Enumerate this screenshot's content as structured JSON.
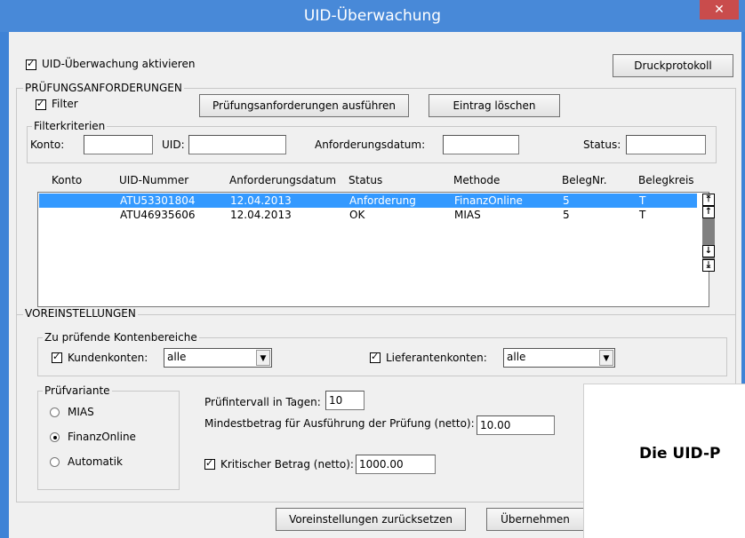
{
  "window": {
    "title": "UID-Überwachung",
    "close_glyph": "✕"
  },
  "top": {
    "activate_label": "UID-Überwachung aktivieren",
    "activate_checked": true,
    "print_button": "Druckprotokoll"
  },
  "pruefung": {
    "group_title": "PRÜFUNGSANFORDERUNGEN",
    "filter_label": "Filter",
    "filter_checked": true,
    "execute_button": "Prüfungsanforderungen ausführen",
    "delete_button": "Eintrag löschen",
    "filter_group_title": "Filterkriterien",
    "konto_label": "Konto:",
    "konto_value": "",
    "uid_label": "UID:",
    "uid_value": "",
    "datum_label": "Anforderungsdatum:",
    "datum_value": "",
    "status_label": "Status:",
    "status_value": ""
  },
  "table": {
    "headers": [
      "Konto",
      "UID-Nummer",
      "Anforderungsdatum",
      "Status",
      "Methode",
      "BelegNr.",
      "Belegkreis"
    ],
    "rows": [
      {
        "konto": "",
        "uid": "ATU53301804",
        "datum": "12.04.2013",
        "status": "Anforderung",
        "methode": "FinanzOnline",
        "belegnr": "5",
        "belegkreis": "T"
      },
      {
        "konto": "",
        "uid": "ATU46935606",
        "datum": "12.04.2013",
        "status": "OK",
        "methode": "MIAS",
        "belegnr": "5",
        "belegkreis": "T"
      }
    ],
    "scroll_top_glyph": "⤒",
    "scroll_up_glyph": "↑",
    "scroll_down_glyph": "↓",
    "scroll_bottom_glyph": "⤓"
  },
  "voreinstellungen": {
    "group_title": "VOREINSTELLUNGEN",
    "konten_group_title": "Zu prüfende Kontenbereiche",
    "kunden_label": "Kundenkonten:",
    "kunden_checked": true,
    "kunden_value": "alle",
    "lieferanten_label": "Lieferantenkonten:",
    "lieferanten_checked": true,
    "lieferanten_value": "alle",
    "variante_group_title": "Prüfvariante",
    "variante_options": [
      "MIAS",
      "FinanzOnline",
      "Automatik"
    ],
    "variante_selected": "FinanzOnline",
    "intervall_label": "Prüfintervall in Tagen:",
    "intervall_value": "10",
    "mindest_label": "Mindestbetrag für Ausführung der Prüfung (netto):",
    "mindest_value": "10.00",
    "kritisch_label": "Kritischer Betrag (netto):",
    "kritisch_checked": true,
    "kritisch_value": "1000.00"
  },
  "bottom": {
    "reset_button": "Voreinstellungen zurücksetzen",
    "apply_button": "Übernehmen"
  },
  "overlay": {
    "text": "Die UID-P"
  },
  "colors": {
    "titlebar": "#4889d8",
    "selection": "#3399ff",
    "close": "#c94c4c"
  }
}
